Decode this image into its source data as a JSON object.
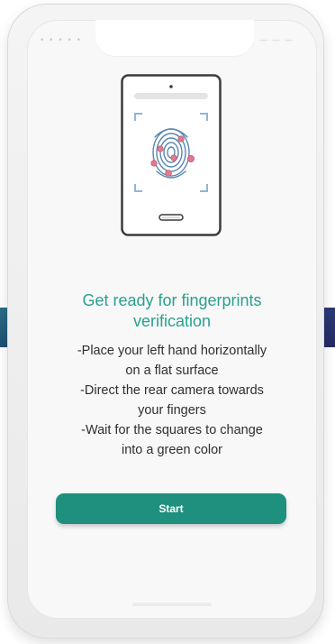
{
  "status_bar": {
    "left": "• • • • •",
    "right": "— — —"
  },
  "content": {
    "title": "Get ready for fingerprints\nverification",
    "instructions": [
      "-Place your left hand horizontally\non a flat surface",
      "-Direct the rear camera towards\nyour fingers",
      "-Wait for the squares to change\ninto a green color"
    ],
    "start_label": "Start"
  },
  "colors": {
    "accent": "#2aa08f",
    "button": "#1f8f7e",
    "fingerprint_dot": "#e07a8f"
  },
  "icons": {
    "illustration": "phone-fingerprint-icon",
    "fingerprint": "fingerprint-icon"
  }
}
